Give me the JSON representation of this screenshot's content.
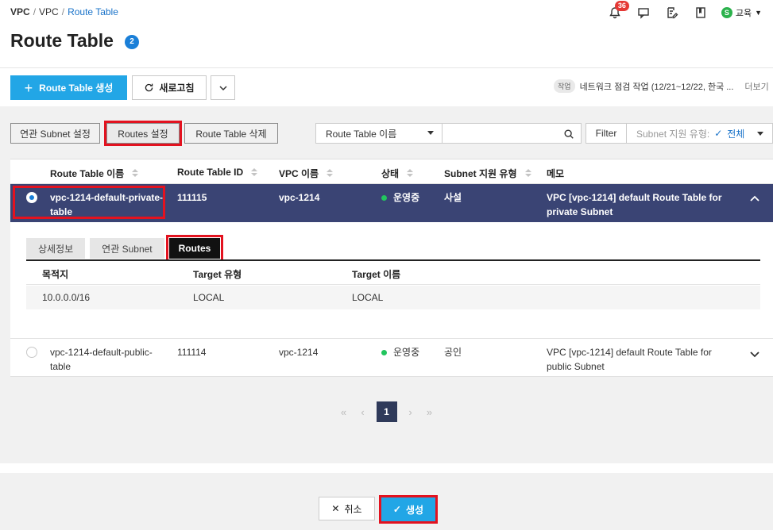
{
  "breadcrumb": {
    "root": "VPC",
    "parent": "VPC",
    "current": "Route Table"
  },
  "page": {
    "title": "Route Table",
    "count": "2"
  },
  "topnav": {
    "notification_count": "36",
    "user_initial": "S",
    "user_label": "교육"
  },
  "actions": {
    "create_label": "Route Table 생성",
    "refresh_label": "새로고침"
  },
  "notice": {
    "tag": "작업",
    "text": "네트워크 점검 작업 (12/21~12/22, 한국 ...",
    "more": "더보기"
  },
  "toolbar": {
    "linked_subnet_label": "연관 Subnet 설정",
    "routes_label": "Routes 설정",
    "delete_label": "Route Table 삭제",
    "search_field_selected": "Route Table 이름",
    "search_value": "",
    "filter_label": "Filter",
    "subnet_type_label": "Subnet 지원 유형:",
    "subnet_type_value": "전체"
  },
  "table": {
    "columns": [
      "Route Table 이름",
      "Route Table ID",
      "VPC 이름",
      "상태",
      "Subnet 지원 유형",
      "메모"
    ],
    "rows": [
      {
        "name_1": "vpc-1214-default-private-",
        "name_2": "table",
        "id": "111115",
        "vpc": "vpc-1214",
        "status": "운영중",
        "subnet_type": "사설",
        "memo_1": "VPC [vpc-1214] default Route Table for",
        "memo_2": "private Subnet"
      },
      {
        "name_1": "vpc-1214-default-public-",
        "name_2": "table",
        "id": "111114",
        "vpc": "vpc-1214",
        "status": "운영중",
        "subnet_type": "공인",
        "memo_1": "VPC [vpc-1214] default Route Table for",
        "memo_2": "public Subnet"
      }
    ]
  },
  "detail": {
    "tabs": [
      "상세정보",
      "연관 Subnet",
      "Routes"
    ],
    "columns": [
      "목적지",
      "Target 유형",
      "Target 이름"
    ],
    "rows": [
      {
        "destination": "10.0.0.0/16",
        "target_type": "LOCAL",
        "target_name": "LOCAL"
      }
    ]
  },
  "pagination": {
    "current": "1"
  },
  "footer": {
    "cancel_label": "취소",
    "create_label": "생성"
  },
  "colors": {
    "primary": "#22a6e6",
    "selected_row": "#3a4474",
    "highlight": "#e3121f",
    "status_running": "#22c55e"
  }
}
